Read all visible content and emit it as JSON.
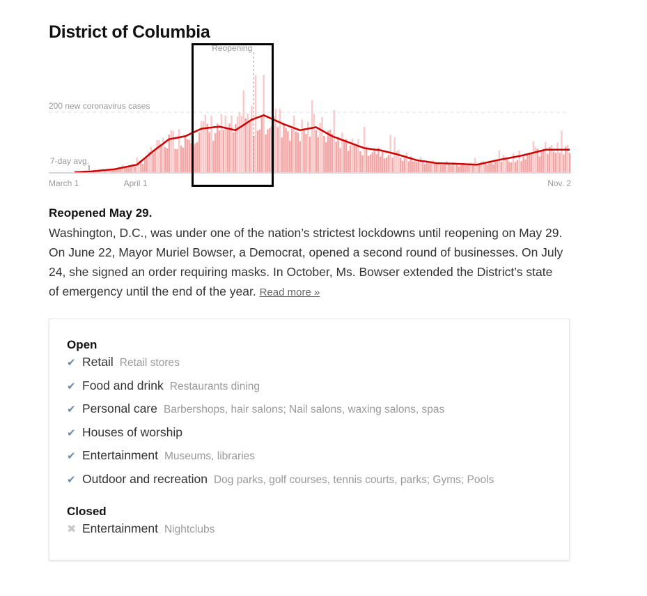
{
  "title": "District of Columbia",
  "summary": {
    "heading": "Reopened May 29.",
    "body": "Washington, D.C., was under one of the nation’s strictest lockdowns until reopening on May 29. On June 22, Mayor Muriel Bowser, a Democrat, opened a second round of businesses. On July 24, she signed an order requiring masks. In October, Ms. Bowser extended the District’s state of emergency until the end of the year.",
    "read_more": "Read more »"
  },
  "status": {
    "open": {
      "title": "Open",
      "icon": "check-icon",
      "items": [
        {
          "name": "Retail",
          "desc": "Retail stores"
        },
        {
          "name": "Food and drink",
          "desc": "Restaurants dining"
        },
        {
          "name": "Personal care",
          "desc": "Barbershops, hair salons; Nail salons, waxing salons, spas"
        },
        {
          "name": "Houses of worship",
          "desc": ""
        },
        {
          "name": "Entertainment",
          "desc": "Museums, libraries"
        },
        {
          "name": "Outdoor and recreation",
          "desc": "Dog parks, golf courses, tennis courts, parks; Gyms; Pools"
        }
      ]
    },
    "closed": {
      "title": "Closed",
      "icon": "x-icon",
      "items": [
        {
          "name": "Entertainment",
          "desc": "Nightclubs"
        }
      ]
    }
  },
  "chart_data": {
    "type": "bar",
    "title": "",
    "xlabel": "",
    "ylabel": "New coronavirus cases",
    "x_start": "March 1",
    "x_end": "Nov. 2",
    "num_days": 247,
    "ylim": [
      0,
      340
    ],
    "gridline": {
      "value": 200,
      "label": "200 new coronavirus cases"
    },
    "avg_label": "7-day avg.",
    "annotation": {
      "label": "Reopening",
      "day": 89
    },
    "x_ticks": [
      {
        "label": "March 1",
        "day": 0
      },
      {
        "label": "April 1",
        "day": 31
      },
      {
        "label": "Nov. 2",
        "day": 246
      }
    ],
    "avg_anchors": [
      [
        0,
        0
      ],
      [
        9,
        3
      ],
      [
        20,
        10
      ],
      [
        31,
        25
      ],
      [
        40,
        75
      ],
      [
        47,
        110
      ],
      [
        55,
        120
      ],
      [
        63,
        145
      ],
      [
        72,
        152
      ],
      [
        80,
        140
      ],
      [
        88,
        175
      ],
      [
        94,
        190
      ],
      [
        104,
        160
      ],
      [
        112,
        140
      ],
      [
        120,
        150
      ],
      [
        128,
        120
      ],
      [
        136,
        100
      ],
      [
        144,
        80
      ],
      [
        152,
        73
      ],
      [
        160,
        60
      ],
      [
        170,
        40
      ],
      [
        180,
        30
      ],
      [
        190,
        28
      ],
      [
        200,
        25
      ],
      [
        210,
        40
      ],
      [
        222,
        55
      ],
      [
        234,
        75
      ],
      [
        246,
        75
      ]
    ],
    "colors": {
      "bar": "#f4a6a6",
      "bar_light": "#f8caca",
      "avg_line": "#cc0000",
      "grid": "#dddddd",
      "axis": "#cccccc",
      "annotation": "#999999"
    }
  }
}
